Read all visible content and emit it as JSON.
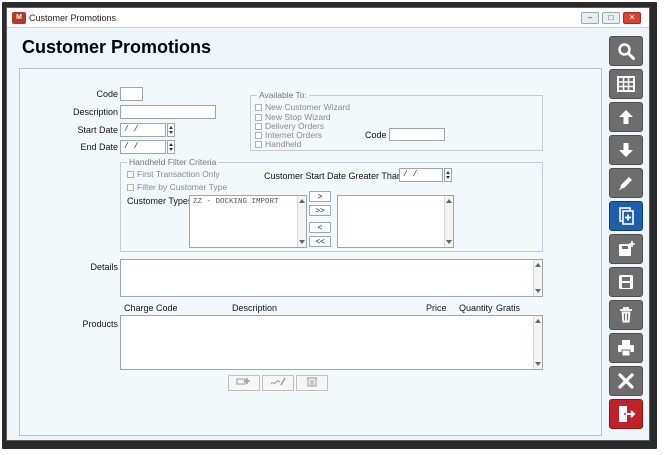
{
  "window": {
    "title": "Customer Promotions",
    "controls": {
      "minimize": "–",
      "restore": "□",
      "close": "✕"
    }
  },
  "page": {
    "heading": "Customer Promotions"
  },
  "form": {
    "code_label": "Code",
    "code_value": "",
    "description_label": "Description",
    "description_value": "",
    "start_date_label": "Start Date",
    "start_date_value": "/ /",
    "end_date_label": "End Date",
    "end_date_value": "/ /"
  },
  "available_to": {
    "title": "Available To:",
    "options": [
      {
        "label": "New Customer Wizard",
        "checked": false
      },
      {
        "label": "New Stop Wizard",
        "checked": false
      },
      {
        "label": "Delivery Orders",
        "checked": false
      },
      {
        "label": "Internet Orders",
        "checked": false
      },
      {
        "label": "Handheld",
        "checked": false
      }
    ],
    "code_label": "Code",
    "code_value": ""
  },
  "handheld": {
    "title": "Handheld Filter Criteria",
    "first_transaction_label": "First Transaction Only",
    "filter_customer_type_label": "Filter by Customer Type",
    "start_date_gt_label": "Customer Start Date Greater Than",
    "start_date_gt_value": "/ /",
    "customer_types_label": "Customer Types",
    "available_types": [
      "ZZ - DOCKING IMPORT"
    ],
    "selected_types": [],
    "move_buttons": {
      "add": ">",
      "add_all": ">>",
      "remove": "<",
      "remove_all": "<<"
    }
  },
  "details": {
    "label": "Details",
    "value": ""
  },
  "products": {
    "label": "Products",
    "columns": [
      "Charge Code",
      "Description",
      "Price",
      "Quantity",
      "Gratis"
    ],
    "rows": []
  },
  "bottom_buttons": [
    {
      "name": "add-product-button",
      "icon": "add-item-icon"
    },
    {
      "name": "edit-product-button",
      "icon": "edit-signature-icon"
    },
    {
      "name": "delete-product-button",
      "icon": "trash-icon"
    }
  ],
  "toolbar": [
    {
      "name": "search",
      "icon": "search-icon"
    },
    {
      "name": "grid",
      "icon": "grid-icon"
    },
    {
      "name": "previous",
      "icon": "arrow-up-icon"
    },
    {
      "name": "next",
      "icon": "arrow-down-icon"
    },
    {
      "name": "edit",
      "icon": "pencil-icon"
    },
    {
      "name": "new",
      "icon": "new-document-icon",
      "active": true
    },
    {
      "name": "copy",
      "icon": "copy-save-icon"
    },
    {
      "name": "save",
      "icon": "floppy-icon"
    },
    {
      "name": "delete",
      "icon": "trash-icon"
    },
    {
      "name": "print",
      "icon": "printer-icon"
    },
    {
      "name": "cancel",
      "icon": "x-icon"
    },
    {
      "name": "exit",
      "icon": "exit-door-icon"
    }
  ],
  "colors": {
    "toolbar_button": "#6d6d6d",
    "toolbar_active": "#1f5ea8",
    "toolbar_exit": "#c0222a",
    "window_background": "#eef6fb"
  }
}
